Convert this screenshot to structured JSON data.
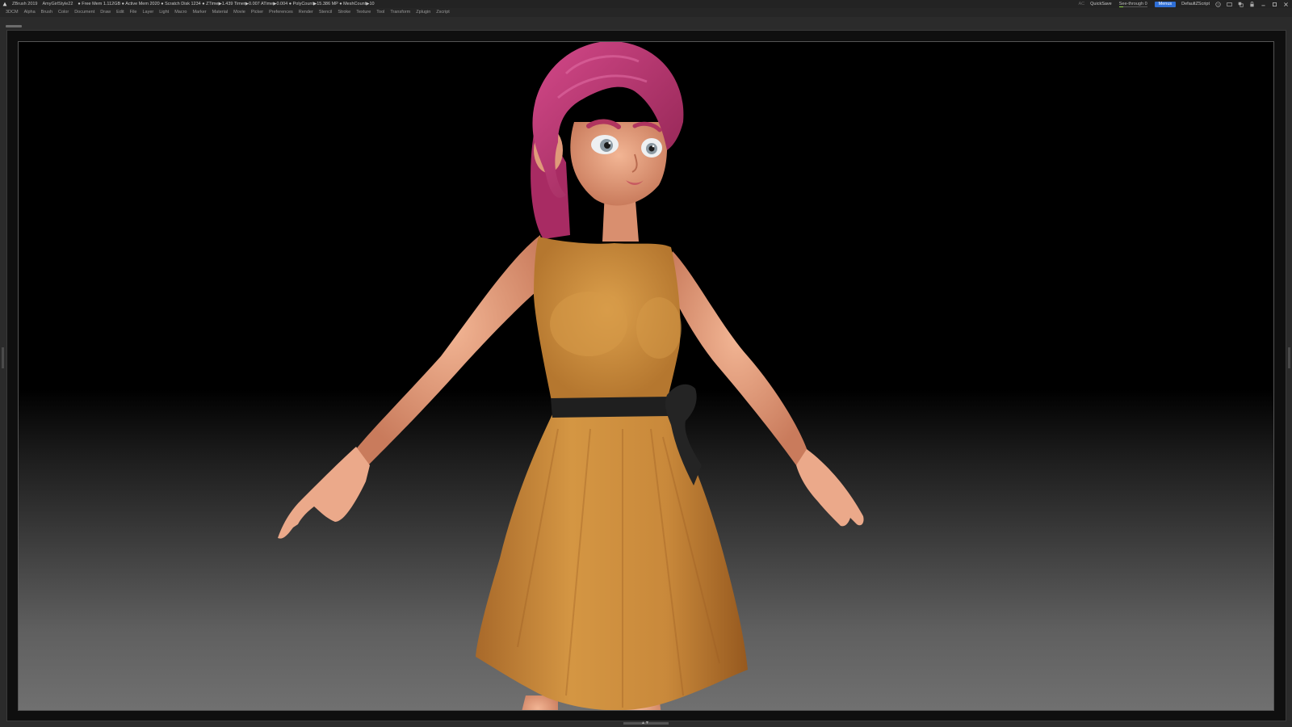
{
  "titlebar": {
    "app_name": "ZBrush 2019",
    "document_name": "AmyGirlStyle22",
    "stats": [
      "● Free Mem 1.112GB ● Active Mem 2020 ● Scratch Disk 1234 ● ZTime▶1.439 Timer▶0.007 ATime▶0.004 ● PolyCount▶15.386 MP ● MeshCount▶10"
    ],
    "right": {
      "ac_label": "AC",
      "quicksave_label": "QuickSave",
      "see_through_label": "See-through",
      "see_through_value": "0",
      "menus_label": "Menus",
      "script_label": "DefaultZScript"
    }
  },
  "menubar": {
    "items": [
      "3DCM",
      "Alpha",
      "Brush",
      "Color",
      "Document",
      "Draw",
      "Edit",
      "File",
      "Layer",
      "Light",
      "Macro",
      "Marker",
      "Material",
      "Movie",
      "Picker",
      "Preferences",
      "Render",
      "Stencil",
      "Stroke",
      "Texture",
      "Tool",
      "Transform",
      "Zplugin",
      "Zscript"
    ]
  },
  "icons": {
    "logo": "zbrush-logo-icon",
    "help": "help-icon",
    "lock": "lock-icon",
    "minimize": "minimize-icon",
    "maximize": "maximize-icon",
    "close": "close-icon"
  },
  "colors": {
    "hair": "#c23a72",
    "dress": "#c88a3a",
    "belt": "#1f1f1f",
    "skin": "#e7a483",
    "menu_accent": "#2f6fd6",
    "see_through_fill": "#8fd24a"
  }
}
